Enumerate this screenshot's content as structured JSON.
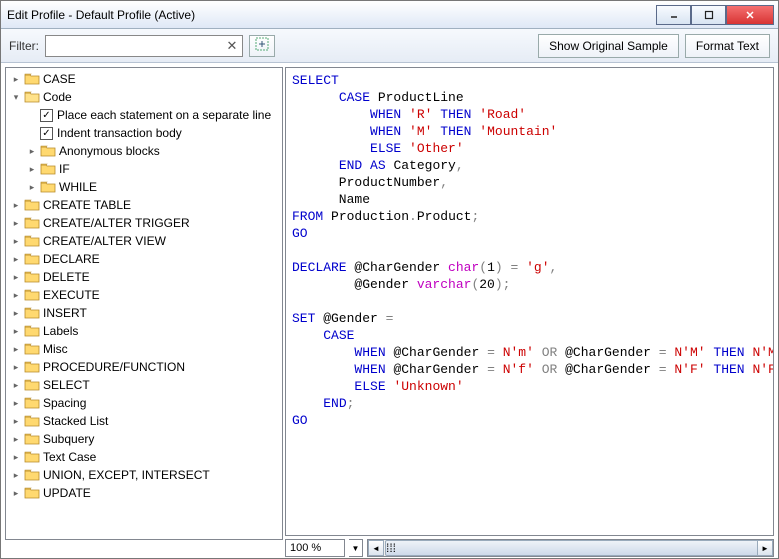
{
  "window": {
    "title": "Edit Profile - Default Profile (Active)"
  },
  "toolbar": {
    "filter_label": "Filter:",
    "filter_value": "",
    "show_original": "Show Original Sample",
    "format_text": "Format Text"
  },
  "tree": {
    "items": [
      {
        "kind": "folder",
        "label": "CASE",
        "depth": 0,
        "expandable": true,
        "open": false
      },
      {
        "kind": "folder",
        "label": "Code",
        "depth": 0,
        "expandable": true,
        "open": true
      },
      {
        "kind": "check",
        "label": "Place each statement on a separate line",
        "depth": 1,
        "checked": true
      },
      {
        "kind": "check",
        "label": "Indent transaction body",
        "depth": 1,
        "checked": true
      },
      {
        "kind": "folder",
        "label": "Anonymous blocks",
        "depth": 1,
        "expandable": true,
        "open": false
      },
      {
        "kind": "folder",
        "label": "IF",
        "depth": 1,
        "expandable": true,
        "open": false
      },
      {
        "kind": "folder",
        "label": "WHILE",
        "depth": 1,
        "expandable": true,
        "open": false
      },
      {
        "kind": "folder",
        "label": "CREATE TABLE",
        "depth": 0,
        "expandable": true,
        "open": false
      },
      {
        "kind": "folder",
        "label": "CREATE/ALTER TRIGGER",
        "depth": 0,
        "expandable": true,
        "open": false
      },
      {
        "kind": "folder",
        "label": "CREATE/ALTER VIEW",
        "depth": 0,
        "expandable": true,
        "open": false
      },
      {
        "kind": "folder",
        "label": "DECLARE",
        "depth": 0,
        "expandable": true,
        "open": false
      },
      {
        "kind": "folder",
        "label": "DELETE",
        "depth": 0,
        "expandable": true,
        "open": false
      },
      {
        "kind": "folder",
        "label": "EXECUTE",
        "depth": 0,
        "expandable": true,
        "open": false
      },
      {
        "kind": "folder",
        "label": "INSERT",
        "depth": 0,
        "expandable": true,
        "open": false
      },
      {
        "kind": "folder",
        "label": "Labels",
        "depth": 0,
        "expandable": true,
        "open": false
      },
      {
        "kind": "folder",
        "label": "Misc",
        "depth": 0,
        "expandable": true,
        "open": false
      },
      {
        "kind": "folder",
        "label": "PROCEDURE/FUNCTION",
        "depth": 0,
        "expandable": true,
        "open": false
      },
      {
        "kind": "folder",
        "label": "SELECT",
        "depth": 0,
        "expandable": true,
        "open": false
      },
      {
        "kind": "folder",
        "label": "Spacing",
        "depth": 0,
        "expandable": true,
        "open": false
      },
      {
        "kind": "folder",
        "label": "Stacked List",
        "depth": 0,
        "expandable": true,
        "open": false
      },
      {
        "kind": "folder",
        "label": "Subquery",
        "depth": 0,
        "expandable": true,
        "open": false
      },
      {
        "kind": "folder",
        "label": "Text Case",
        "depth": 0,
        "expandable": true,
        "open": false
      },
      {
        "kind": "folder",
        "label": "UNION, EXCEPT, INTERSECT",
        "depth": 0,
        "expandable": true,
        "open": false
      },
      {
        "kind": "folder",
        "label": "UPDATE",
        "depth": 0,
        "expandable": true,
        "open": false
      }
    ]
  },
  "code": {
    "lines": [
      [
        {
          "t": "SELECT",
          "c": "kw"
        }
      ],
      [
        {
          "t": "      ",
          "c": ""
        },
        {
          "t": "CASE",
          "c": "kw"
        },
        {
          "t": " ProductLine",
          "c": ""
        }
      ],
      [
        {
          "t": "          ",
          "c": ""
        },
        {
          "t": "WHEN",
          "c": "kw"
        },
        {
          "t": " ",
          "c": ""
        },
        {
          "t": "'R'",
          "c": "str"
        },
        {
          "t": " ",
          "c": ""
        },
        {
          "t": "THEN",
          "c": "kw"
        },
        {
          "t": " ",
          "c": ""
        },
        {
          "t": "'Road'",
          "c": "str"
        }
      ],
      [
        {
          "t": "          ",
          "c": ""
        },
        {
          "t": "WHEN",
          "c": "kw"
        },
        {
          "t": " ",
          "c": ""
        },
        {
          "t": "'M'",
          "c": "str"
        },
        {
          "t": " ",
          "c": ""
        },
        {
          "t": "THEN",
          "c": "kw"
        },
        {
          "t": " ",
          "c": ""
        },
        {
          "t": "'Mountain'",
          "c": "str"
        }
      ],
      [
        {
          "t": "          ",
          "c": ""
        },
        {
          "t": "ELSE",
          "c": "kw"
        },
        {
          "t": " ",
          "c": ""
        },
        {
          "t": "'Other'",
          "c": "str"
        }
      ],
      [
        {
          "t": "      ",
          "c": ""
        },
        {
          "t": "END",
          "c": "kw"
        },
        {
          "t": " ",
          "c": ""
        },
        {
          "t": "AS",
          "c": "kw"
        },
        {
          "t": " Category",
          "c": ""
        },
        {
          "t": ",",
          "c": "op"
        }
      ],
      [
        {
          "t": "      ProductNumber",
          "c": ""
        },
        {
          "t": ",",
          "c": "op"
        }
      ],
      [
        {
          "t": "      Name",
          "c": ""
        }
      ],
      [
        {
          "t": "FROM",
          "c": "kw"
        },
        {
          "t": " Production",
          "c": ""
        },
        {
          "t": ".",
          "c": "op"
        },
        {
          "t": "Product",
          "c": ""
        },
        {
          "t": ";",
          "c": "op"
        }
      ],
      [
        {
          "t": "GO",
          "c": "kw"
        }
      ],
      [],
      [
        {
          "t": "DECLARE",
          "c": "kw"
        },
        {
          "t": " @CharGender ",
          "c": ""
        },
        {
          "t": "char",
          "c": "fn"
        },
        {
          "t": "(",
          "c": "op"
        },
        {
          "t": "1",
          "c": "num"
        },
        {
          "t": ")",
          "c": "op"
        },
        {
          "t": " ",
          "c": ""
        },
        {
          "t": "=",
          "c": "op"
        },
        {
          "t": " ",
          "c": ""
        },
        {
          "t": "'g'",
          "c": "str"
        },
        {
          "t": ",",
          "c": "op"
        }
      ],
      [
        {
          "t": "        @Gender ",
          "c": ""
        },
        {
          "t": "varchar",
          "c": "fn"
        },
        {
          "t": "(",
          "c": "op"
        },
        {
          "t": "20",
          "c": "num"
        },
        {
          "t": ")",
          "c": "op"
        },
        {
          "t": ";",
          "c": "op"
        }
      ],
      [],
      [
        {
          "t": "SET",
          "c": "kw"
        },
        {
          "t": " @Gender ",
          "c": ""
        },
        {
          "t": "=",
          "c": "op"
        }
      ],
      [
        {
          "t": "    ",
          "c": ""
        },
        {
          "t": "CASE",
          "c": "kw"
        }
      ],
      [
        {
          "t": "        ",
          "c": ""
        },
        {
          "t": "WHEN",
          "c": "kw"
        },
        {
          "t": " @CharGender ",
          "c": ""
        },
        {
          "t": "=",
          "c": "op"
        },
        {
          "t": " ",
          "c": ""
        },
        {
          "t": "N'm'",
          "c": "str"
        },
        {
          "t": " ",
          "c": ""
        },
        {
          "t": "OR",
          "c": "op"
        },
        {
          "t": " @CharGender ",
          "c": ""
        },
        {
          "t": "=",
          "c": "op"
        },
        {
          "t": " ",
          "c": ""
        },
        {
          "t": "N'M'",
          "c": "str"
        },
        {
          "t": " ",
          "c": ""
        },
        {
          "t": "THEN",
          "c": "kw"
        },
        {
          "t": " ",
          "c": ""
        },
        {
          "t": "N'Male",
          "c": "str"
        }
      ],
      [
        {
          "t": "        ",
          "c": ""
        },
        {
          "t": "WHEN",
          "c": "kw"
        },
        {
          "t": " @CharGender ",
          "c": ""
        },
        {
          "t": "=",
          "c": "op"
        },
        {
          "t": " ",
          "c": ""
        },
        {
          "t": "N'f'",
          "c": "str"
        },
        {
          "t": " ",
          "c": ""
        },
        {
          "t": "OR",
          "c": "op"
        },
        {
          "t": " @CharGender ",
          "c": ""
        },
        {
          "t": "=",
          "c": "op"
        },
        {
          "t": " ",
          "c": ""
        },
        {
          "t": "N'F'",
          "c": "str"
        },
        {
          "t": " ",
          "c": ""
        },
        {
          "t": "THEN",
          "c": "kw"
        },
        {
          "t": " ",
          "c": ""
        },
        {
          "t": "N'Fema",
          "c": "str"
        }
      ],
      [
        {
          "t": "        ",
          "c": ""
        },
        {
          "t": "ELSE",
          "c": "kw"
        },
        {
          "t": " ",
          "c": ""
        },
        {
          "t": "'Unknown'",
          "c": "str"
        }
      ],
      [
        {
          "t": "    ",
          "c": ""
        },
        {
          "t": "END",
          "c": "kw"
        },
        {
          "t": ";",
          "c": "op"
        }
      ],
      [
        {
          "t": "GO",
          "c": "kw"
        }
      ]
    ]
  },
  "status": {
    "zoom": "100 %"
  }
}
